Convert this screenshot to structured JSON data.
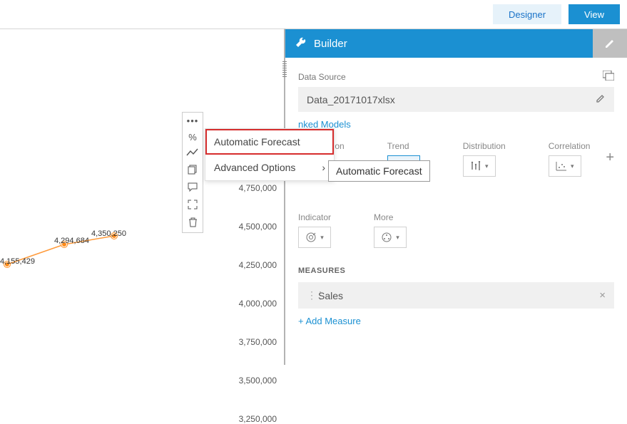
{
  "topbar": {
    "designer_label": "Designer",
    "view_label": "View"
  },
  "panel": {
    "title": "Builder",
    "data_source_label": "Data Source",
    "data_source_value": "Data_20171017xlsx",
    "linked_models": "nked Models",
    "plus": "+",
    "measures_heading": "MEASURES",
    "measure_value": "Sales",
    "measure_close": "×",
    "add_measure": "+ Add Measure",
    "chart_types": {
      "comparison": "Comparison",
      "trend": "Trend",
      "distribution": "Distribution",
      "correlation": "Correlation",
      "indicator": "Indicator",
      "more": "More"
    }
  },
  "flyout": {
    "auto_forecast": "Automatic Forecast",
    "advanced": "Advanced Options",
    "chevron": "›"
  },
  "tooltip": {
    "text": "Automatic Forecast"
  },
  "toolbar": {
    "percent": "%"
  },
  "chart_data": {
    "type": "line",
    "title": "",
    "xlabel": "",
    "ylabel": "",
    "ylim": [
      3250000,
      4750000
    ],
    "y_ticks": [
      "4,750,000",
      "4,500,000",
      "4,250,000",
      "4,000,000",
      "3,750,000",
      "3,500,000",
      "3,250,000"
    ],
    "series": [
      {
        "name": "Sales",
        "values": [
          4155429,
          4294684,
          4350250
        ]
      }
    ],
    "labels": {
      "p1": "4,155,429",
      "p2": "4,294,684",
      "p3": "4,350,250"
    }
  }
}
